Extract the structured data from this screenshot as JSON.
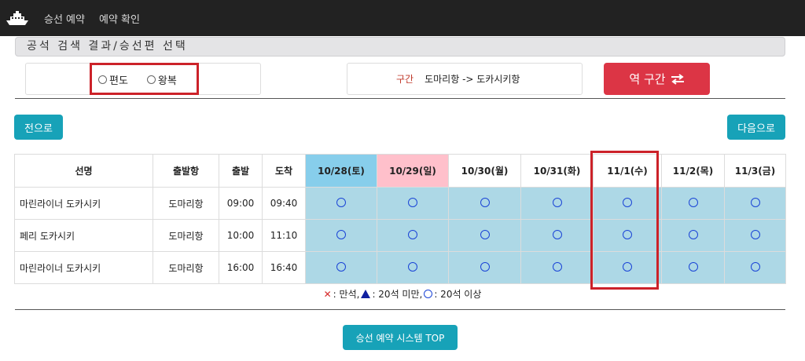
{
  "nav": {
    "links": [
      "승선 예약",
      "예약 확인"
    ]
  },
  "result_title": "공석 검색 결과/승선편 선택",
  "trip_type": {
    "options": [
      "편도",
      "왕복"
    ]
  },
  "route": {
    "label": "구간",
    "value": "도마리항 -> 도카시키항"
  },
  "reverse_button": {
    "label": "역 구간",
    "icon": "swap-arrows-icon"
  },
  "prev_button": "전으로",
  "next_button": "다음으로",
  "table": {
    "headers": [
      "선명",
      "출발항",
      "출발",
      "도착"
    ],
    "dates": [
      "10/28(토)",
      "10/29(일)",
      "10/30(월)",
      "10/31(화)",
      "11/1(수)",
      "11/2(목)",
      "11/3(금)"
    ],
    "rows": [
      {
        "ship": "마린라이너 도카시키",
        "port": "도마리항",
        "depart": "09:00",
        "arrive": "09:40"
      },
      {
        "ship": "페리 도카시키",
        "port": "도마리항",
        "depart": "10:00",
        "arrive": "11:10"
      },
      {
        "ship": "마린라이너 도카시키",
        "port": "도마리항",
        "depart": "16:00",
        "arrive": "16:40"
      }
    ]
  },
  "legend": {
    "full": ": 만석,",
    "few": ": 20석 미만,",
    "many": ": 20석 이상"
  },
  "top_button": "승선 예약 시스템 TOP",
  "colors": {
    "saturday": "#87ceeb",
    "sunday": "#ffc0cb",
    "available": "#add8e6",
    "accent": "#17a2b8",
    "danger": "#dc3545",
    "highlight": "#cc2229"
  }
}
